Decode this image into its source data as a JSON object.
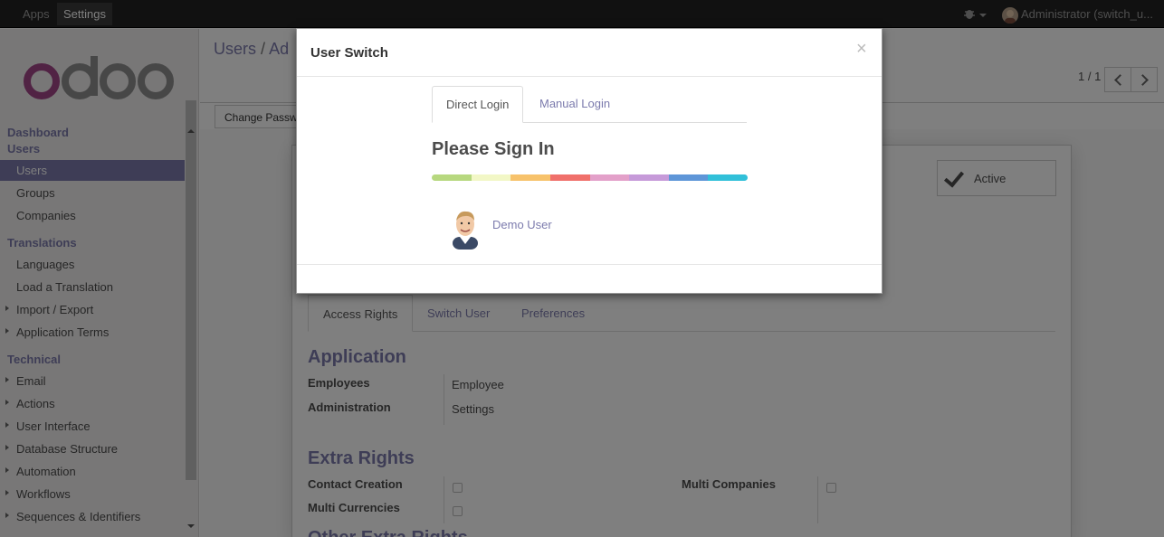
{
  "topbar": {
    "apps_label": "Apps",
    "settings_label": "Settings",
    "user_label": "Administrator (switch_u..."
  },
  "sidebar": {
    "sections": [
      {
        "label": "Dashboard"
      },
      {
        "label": "Users"
      },
      {
        "label": "Translations"
      },
      {
        "label": "Technical"
      }
    ],
    "items": [
      {
        "label": "Users",
        "active": true
      },
      {
        "label": "Groups"
      },
      {
        "label": "Companies"
      },
      {
        "label": "Languages"
      },
      {
        "label": "Load a Translation"
      },
      {
        "label": "Import / Export"
      },
      {
        "label": "Application Terms"
      },
      {
        "label": "Email"
      },
      {
        "label": "Actions"
      },
      {
        "label": "User Interface"
      },
      {
        "label": "Database Structure"
      },
      {
        "label": "Automation"
      },
      {
        "label": "Workflows"
      },
      {
        "label": "Sequences & Identifiers"
      }
    ]
  },
  "header": {
    "breadcrumb_root": "Users",
    "breadcrumb_sep": "/",
    "breadcrumb_current": "Ad",
    "pager": "1 / 1",
    "change_password": "Change Passw"
  },
  "form": {
    "active_label": "Active",
    "tabs": [
      {
        "label": "Access Rights",
        "active": true
      },
      {
        "label": "Switch User"
      },
      {
        "label": "Preferences"
      }
    ],
    "application_heading": "Application",
    "employees_label": "Employees",
    "employees_value": "Employee",
    "administration_label": "Administration",
    "administration_value": "Settings",
    "extra_rights_heading": "Extra Rights",
    "contact_creation_label": "Contact Creation",
    "multi_currencies_label": "Multi Currencies",
    "multi_companies_label": "Multi Companies",
    "other_heading": "Other Extra Rights"
  },
  "modal": {
    "title": "User Switch",
    "close": "×",
    "tabs": [
      {
        "label": "Direct Login",
        "active": true
      },
      {
        "label": "Manual Login"
      }
    ],
    "heading": "Please Sign In",
    "rainbow_colors": [
      "#b7d87f",
      "#f2f7c6",
      "#f7c26b",
      "#f0706b",
      "#e3a0c9",
      "#c69ad9",
      "#5e96d8",
      "#31c0d9"
    ],
    "users": [
      {
        "name": "Demo User"
      }
    ]
  },
  "colors": {
    "accent": "#7c7bad",
    "topbar": "#222222"
  }
}
